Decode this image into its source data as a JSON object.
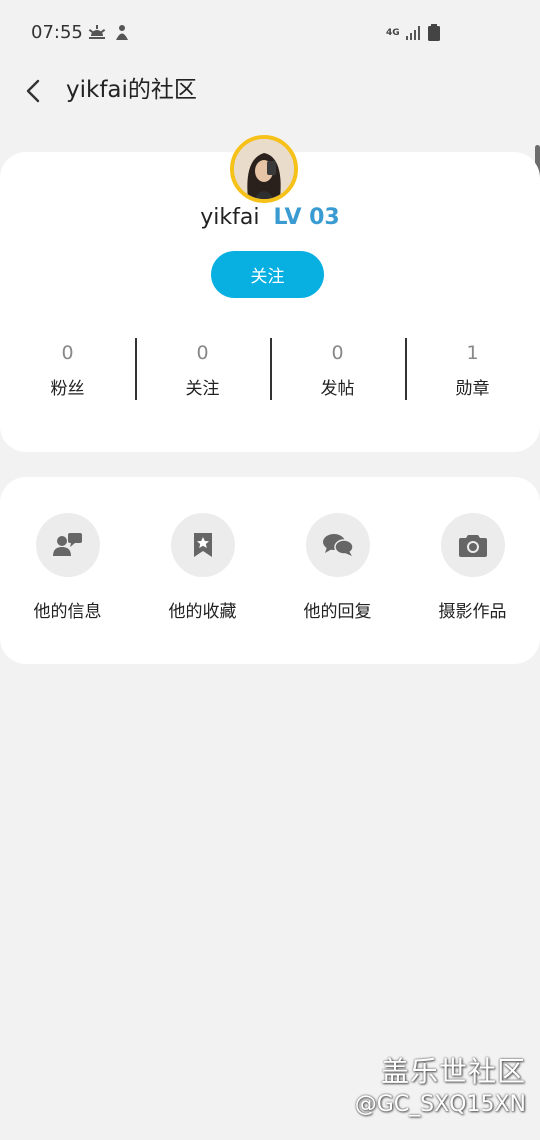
{
  "status_bar": {
    "time": "07:55",
    "network": "4G",
    "icons": [
      "weather-icon",
      "notification-icon",
      "signal-icon",
      "battery-icon"
    ]
  },
  "header": {
    "title": "yikfai的社区",
    "back_icon": "chevron-left-icon"
  },
  "profile": {
    "username": "yikfai",
    "level": "LV 03",
    "follow_label": "关注",
    "stats": [
      {
        "value": "0",
        "label": "粉丝"
      },
      {
        "value": "0",
        "label": "关注"
      },
      {
        "value": "0",
        "label": "发帖"
      },
      {
        "value": "1",
        "label": "勋章"
      }
    ]
  },
  "menu": [
    {
      "label": "他的信息",
      "icon": "chat-person-icon"
    },
    {
      "label": "他的收藏",
      "icon": "bookmark-star-icon"
    },
    {
      "label": "他的回复",
      "icon": "chat-bubbles-icon"
    },
    {
      "label": "摄影作品",
      "icon": "camera-icon"
    }
  ],
  "watermark": {
    "brand": "盖乐世社区",
    "handle": "@GC_SXQ15XN"
  },
  "colors": {
    "accent": "#08b0e2",
    "level": "#3a9bd2",
    "avatar_ring": "#f6c21a",
    "background": "#f2f2f2"
  }
}
